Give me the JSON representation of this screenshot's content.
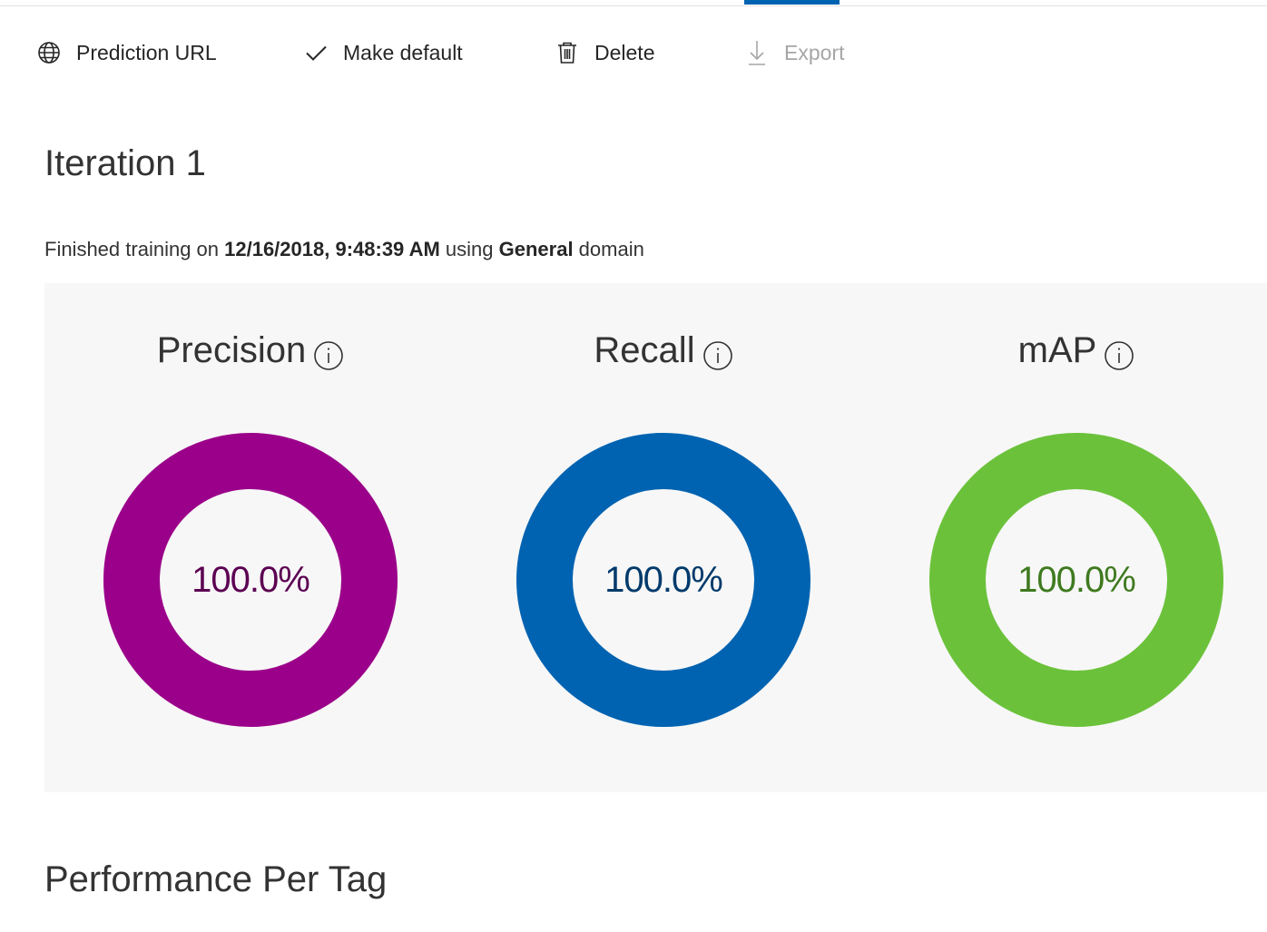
{
  "toolbar": {
    "prediction_url": "Prediction URL",
    "make_default": "Make default",
    "delete": "Delete",
    "export": "Export"
  },
  "iteration": {
    "title": "Iteration 1",
    "info_prefix": "Finished training on ",
    "date": "12/16/2018, 9:48:39 AM",
    "info_mid": " using ",
    "domain": "General",
    "info_suffix": " domain"
  },
  "metrics": [
    {
      "label": "Precision",
      "value_text": "100.0%",
      "value": 1.0,
      "ring_color": "#9b008a",
      "text_color": "#5c0052"
    },
    {
      "label": "Recall",
      "value_text": "100.0%",
      "value": 1.0,
      "ring_color": "#0063b1",
      "text_color": "#003a6b"
    },
    {
      "label": "mAP",
      "value_text": "100.0%",
      "value": 1.0,
      "ring_color": "#6bc23a",
      "text_color": "#3f7a1f"
    }
  ],
  "section": {
    "performance_per_tag": "Performance Per Tag"
  },
  "colors": {
    "accent": "#0063b1",
    "panel_bg": "#f7f7f7"
  }
}
